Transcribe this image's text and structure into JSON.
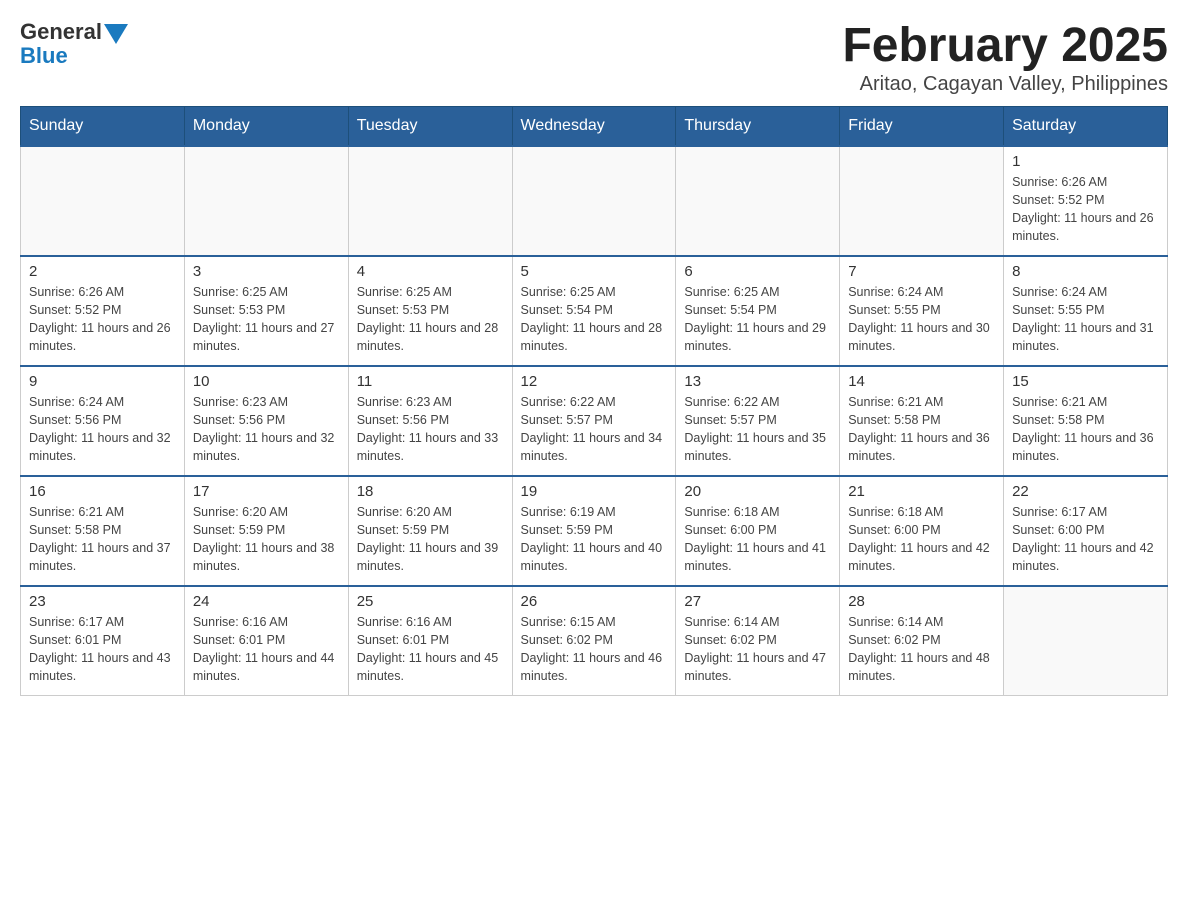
{
  "header": {
    "logo": {
      "general": "General",
      "blue": "Blue"
    },
    "title": "February 2025",
    "subtitle": "Aritao, Cagayan Valley, Philippines"
  },
  "weekdays": [
    "Sunday",
    "Monday",
    "Tuesday",
    "Wednesday",
    "Thursday",
    "Friday",
    "Saturday"
  ],
  "weeks": [
    [
      {
        "day": "",
        "info": ""
      },
      {
        "day": "",
        "info": ""
      },
      {
        "day": "",
        "info": ""
      },
      {
        "day": "",
        "info": ""
      },
      {
        "day": "",
        "info": ""
      },
      {
        "day": "",
        "info": ""
      },
      {
        "day": "1",
        "info": "Sunrise: 6:26 AM\nSunset: 5:52 PM\nDaylight: 11 hours and 26 minutes."
      }
    ],
    [
      {
        "day": "2",
        "info": "Sunrise: 6:26 AM\nSunset: 5:52 PM\nDaylight: 11 hours and 26 minutes."
      },
      {
        "day": "3",
        "info": "Sunrise: 6:25 AM\nSunset: 5:53 PM\nDaylight: 11 hours and 27 minutes."
      },
      {
        "day": "4",
        "info": "Sunrise: 6:25 AM\nSunset: 5:53 PM\nDaylight: 11 hours and 28 minutes."
      },
      {
        "day": "5",
        "info": "Sunrise: 6:25 AM\nSunset: 5:54 PM\nDaylight: 11 hours and 28 minutes."
      },
      {
        "day": "6",
        "info": "Sunrise: 6:25 AM\nSunset: 5:54 PM\nDaylight: 11 hours and 29 minutes."
      },
      {
        "day": "7",
        "info": "Sunrise: 6:24 AM\nSunset: 5:55 PM\nDaylight: 11 hours and 30 minutes."
      },
      {
        "day": "8",
        "info": "Sunrise: 6:24 AM\nSunset: 5:55 PM\nDaylight: 11 hours and 31 minutes."
      }
    ],
    [
      {
        "day": "9",
        "info": "Sunrise: 6:24 AM\nSunset: 5:56 PM\nDaylight: 11 hours and 32 minutes."
      },
      {
        "day": "10",
        "info": "Sunrise: 6:23 AM\nSunset: 5:56 PM\nDaylight: 11 hours and 32 minutes."
      },
      {
        "day": "11",
        "info": "Sunrise: 6:23 AM\nSunset: 5:56 PM\nDaylight: 11 hours and 33 minutes."
      },
      {
        "day": "12",
        "info": "Sunrise: 6:22 AM\nSunset: 5:57 PM\nDaylight: 11 hours and 34 minutes."
      },
      {
        "day": "13",
        "info": "Sunrise: 6:22 AM\nSunset: 5:57 PM\nDaylight: 11 hours and 35 minutes."
      },
      {
        "day": "14",
        "info": "Sunrise: 6:21 AM\nSunset: 5:58 PM\nDaylight: 11 hours and 36 minutes."
      },
      {
        "day": "15",
        "info": "Sunrise: 6:21 AM\nSunset: 5:58 PM\nDaylight: 11 hours and 36 minutes."
      }
    ],
    [
      {
        "day": "16",
        "info": "Sunrise: 6:21 AM\nSunset: 5:58 PM\nDaylight: 11 hours and 37 minutes."
      },
      {
        "day": "17",
        "info": "Sunrise: 6:20 AM\nSunset: 5:59 PM\nDaylight: 11 hours and 38 minutes."
      },
      {
        "day": "18",
        "info": "Sunrise: 6:20 AM\nSunset: 5:59 PM\nDaylight: 11 hours and 39 minutes."
      },
      {
        "day": "19",
        "info": "Sunrise: 6:19 AM\nSunset: 5:59 PM\nDaylight: 11 hours and 40 minutes."
      },
      {
        "day": "20",
        "info": "Sunrise: 6:18 AM\nSunset: 6:00 PM\nDaylight: 11 hours and 41 minutes."
      },
      {
        "day": "21",
        "info": "Sunrise: 6:18 AM\nSunset: 6:00 PM\nDaylight: 11 hours and 42 minutes."
      },
      {
        "day": "22",
        "info": "Sunrise: 6:17 AM\nSunset: 6:00 PM\nDaylight: 11 hours and 42 minutes."
      }
    ],
    [
      {
        "day": "23",
        "info": "Sunrise: 6:17 AM\nSunset: 6:01 PM\nDaylight: 11 hours and 43 minutes."
      },
      {
        "day": "24",
        "info": "Sunrise: 6:16 AM\nSunset: 6:01 PM\nDaylight: 11 hours and 44 minutes."
      },
      {
        "day": "25",
        "info": "Sunrise: 6:16 AM\nSunset: 6:01 PM\nDaylight: 11 hours and 45 minutes."
      },
      {
        "day": "26",
        "info": "Sunrise: 6:15 AM\nSunset: 6:02 PM\nDaylight: 11 hours and 46 minutes."
      },
      {
        "day": "27",
        "info": "Sunrise: 6:14 AM\nSunset: 6:02 PM\nDaylight: 11 hours and 47 minutes."
      },
      {
        "day": "28",
        "info": "Sunrise: 6:14 AM\nSunset: 6:02 PM\nDaylight: 11 hours and 48 minutes."
      },
      {
        "day": "",
        "info": ""
      }
    ]
  ]
}
